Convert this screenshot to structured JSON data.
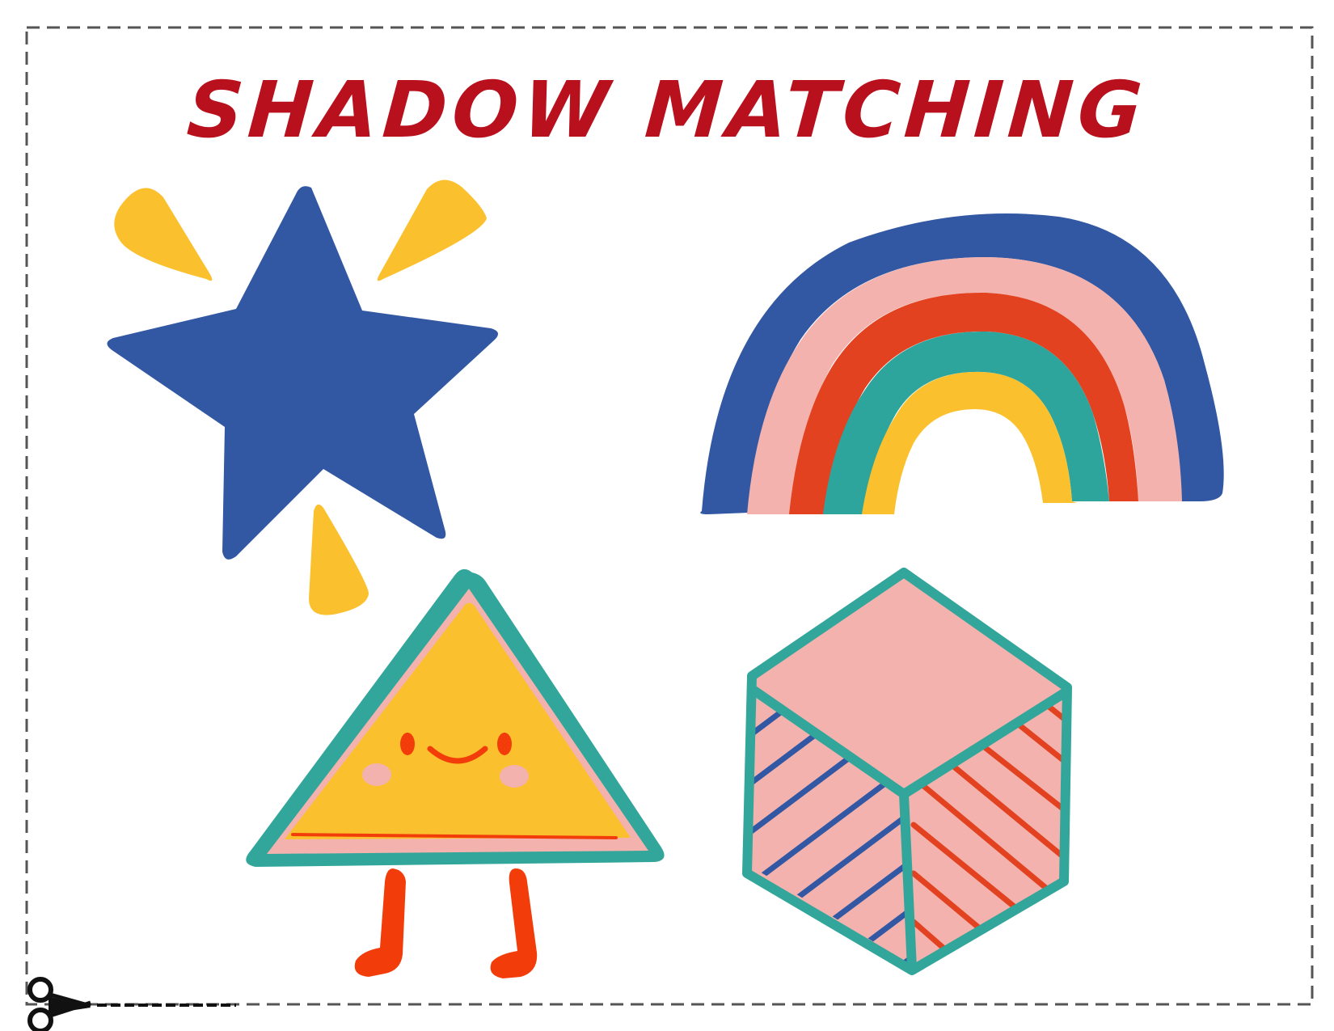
{
  "worksheet": {
    "title": "SHADOW MATCHING"
  },
  "colors": {
    "title": "#b8101d",
    "border": "#555555",
    "star_blue": "#3258a4",
    "accent_yellow": "#fbc02d",
    "rainbow_pink": "#f3b2ad",
    "rainbow_red": "#e2421f",
    "rainbow_teal": "#2ea59c",
    "triangle_outline": "#33a69b",
    "legs": "#f23d0a",
    "cube_stripe_red": "#e2421f"
  },
  "shapes": [
    {
      "name": "star",
      "icon": "star-with-sparkles"
    },
    {
      "name": "rainbow",
      "icon": "rainbow-arch"
    },
    {
      "name": "triangle",
      "icon": "smiling-triangle-character"
    },
    {
      "name": "cube",
      "icon": "striped-cube"
    }
  ],
  "cut_guide": {
    "icon": "scissors-icon"
  }
}
